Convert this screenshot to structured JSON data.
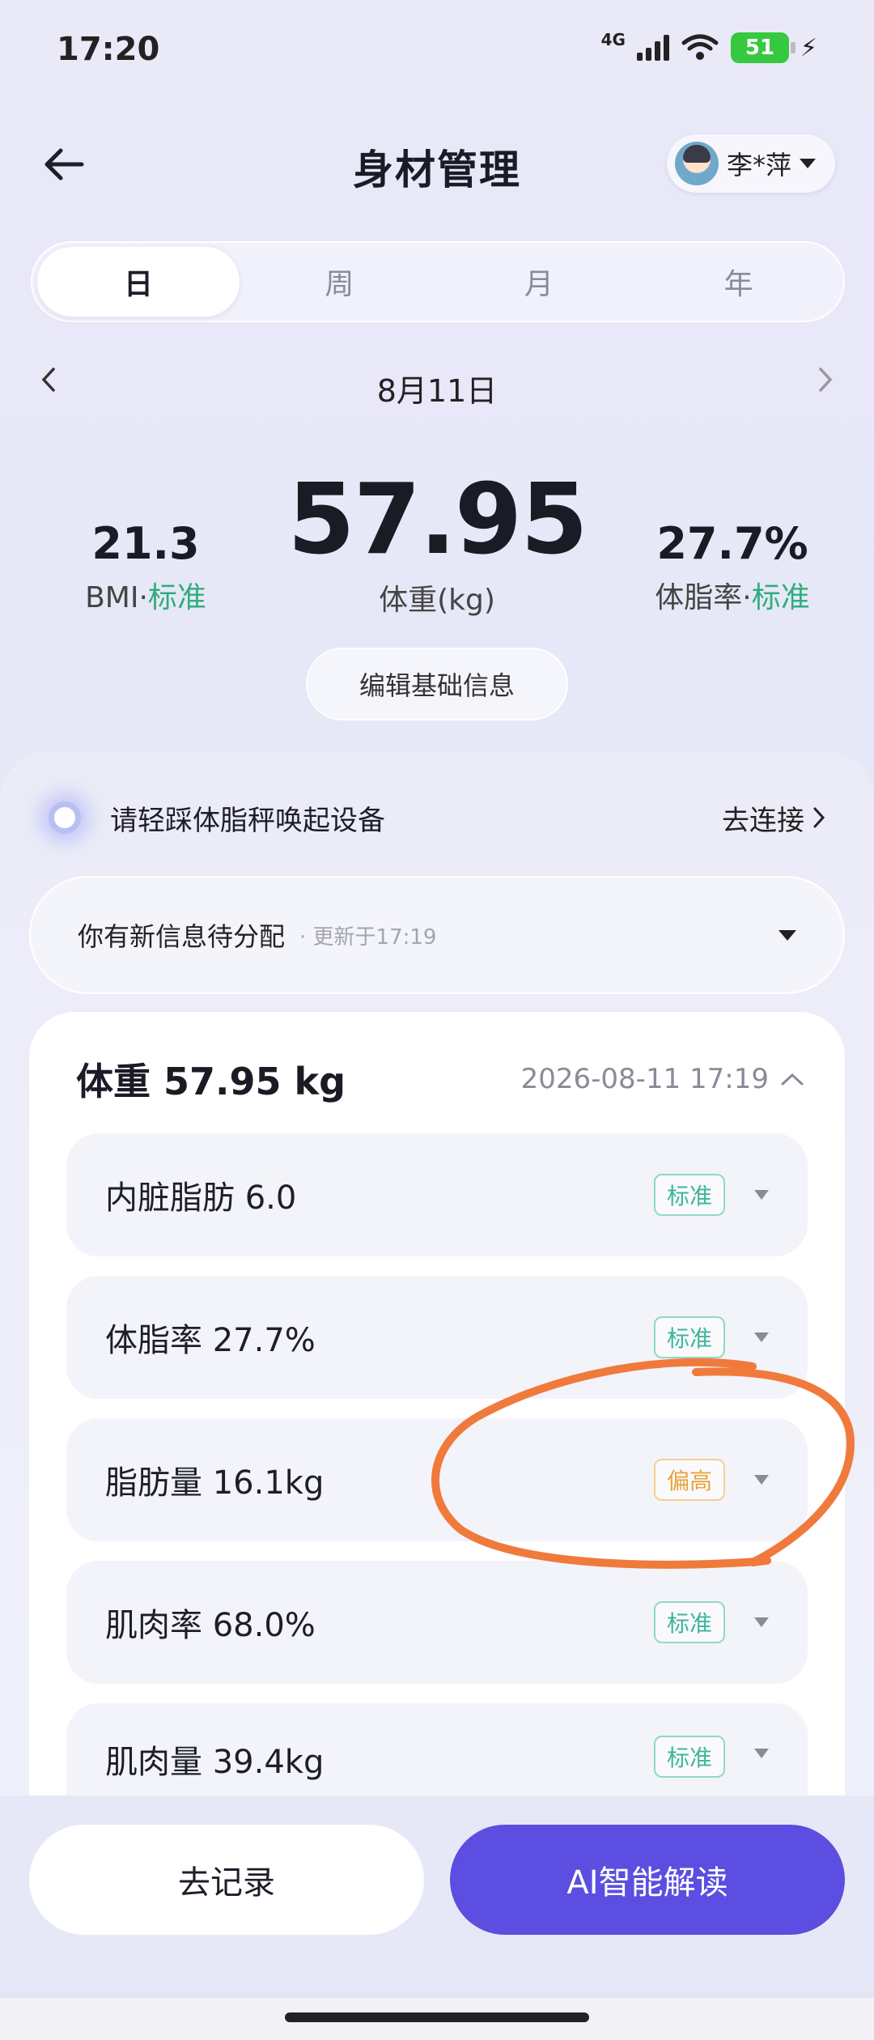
{
  "status_bar": {
    "time": "17:20",
    "network": "4G",
    "battery": "51"
  },
  "header": {
    "title": "身材管理",
    "user_name": "李*萍"
  },
  "tabs": [
    {
      "label": "日",
      "active": true
    },
    {
      "label": "周",
      "active": false
    },
    {
      "label": "月",
      "active": false
    },
    {
      "label": "年",
      "active": false
    }
  ],
  "date_nav": {
    "date": "8月11日"
  },
  "metrics": {
    "bmi": {
      "value": "21.3",
      "label": "BMI",
      "status": "标准"
    },
    "weight": {
      "value": "57.95",
      "label": "体重(kg)"
    },
    "body_fat": {
      "value": "27.7%",
      "label": "体脂率",
      "status": "标准"
    }
  },
  "edit_button": "编辑基础信息",
  "device": {
    "prompt": "请轻踩体脂秤唤起设备",
    "link": "去连接"
  },
  "notice": {
    "text": "你有新信息待分配",
    "updated": "· 更新于17:19"
  },
  "record": {
    "title_prefix": "体重",
    "title_value": "57.95 kg",
    "datetime": "2026-08-11 17:19",
    "items": [
      {
        "label": "内脏脂肪 6.0",
        "status": "标准",
        "level": "standard"
      },
      {
        "label": "体脂率 27.7%",
        "status": "标准",
        "level": "standard"
      },
      {
        "label": "脂肪量 16.1kg",
        "status": "偏高",
        "level": "high"
      },
      {
        "label": "肌肉率 68.0%",
        "status": "标准",
        "level": "standard"
      },
      {
        "label": "肌肉量 39.4kg",
        "status": "标准",
        "level": "standard"
      }
    ]
  },
  "actions": {
    "record": "去记录",
    "ai": "AI智能解读"
  },
  "colors": {
    "accent": "#5b4ee0",
    "standard": "#3db59a",
    "high": "#e8a33a",
    "annotation": "#f07a3c"
  }
}
